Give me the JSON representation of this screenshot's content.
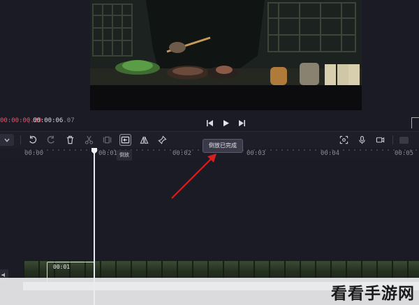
{
  "player": {
    "time_current": "00:00:00.29",
    "time_separator": "|",
    "time_total_main": "00:00:06",
    "time_total_frac": ".07"
  },
  "toolbar": {
    "tooltip_reverse": "倒放",
    "tooltip_done": "倒放已完成"
  },
  "ruler": {
    "ticks": [
      "00:00",
      "00:01",
      "00:02",
      "00:03",
      "00:04",
      "00:05"
    ]
  },
  "clip": {
    "label": "00:01"
  },
  "colors": {
    "accent_time": "#e0556b",
    "arrow": "#d42020"
  },
  "watermark": {
    "text": "看看手游网"
  }
}
